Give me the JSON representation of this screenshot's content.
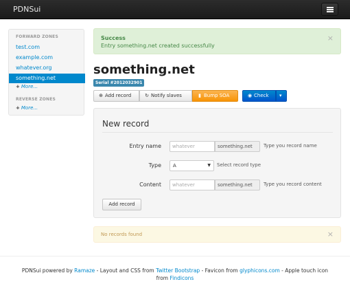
{
  "navbar": {
    "brand": "PDNSui"
  },
  "sidebar": {
    "forward_header": "FORWARD ZONES",
    "forward_items": [
      "test.com",
      "example.com",
      "whatever.org",
      "something.net"
    ],
    "forward_more": "More...",
    "reverse_header": "REVERSE ZONES",
    "reverse_more": "More..."
  },
  "alert": {
    "title": "Success",
    "message": "Entry something.net created successfully",
    "close": "×"
  },
  "zone": {
    "title": "something.net",
    "serial": "Serial #2012032901"
  },
  "toolbar": {
    "add_record": "Add record",
    "notify": "Notify slaves",
    "bump": "Bump SOA",
    "check": "Check",
    "caret": "▾"
  },
  "form": {
    "legend": "New record",
    "entry_label": "Entry name",
    "entry_placeholder": "whatever",
    "entry_addon": "something.net",
    "entry_help": "Type you record name",
    "type_label": "Type",
    "type_value": "A",
    "type_help": "Select record type",
    "content_label": "Content",
    "content_placeholder": "whatever",
    "content_addon": "something.net",
    "content_help": "Type you record content",
    "submit": "Add record"
  },
  "records": {
    "empty": "No records found",
    "close": "×"
  },
  "footer": {
    "t1": "PDNSui powered by ",
    "ramaze": "Ramaze",
    "t2": " - Layout and CSS from ",
    "bootstrap": "Twitter Bootstrap",
    "t3": " - Favicon from ",
    "glyph": "glyphicons.com",
    "t4": " - Apple touch icon",
    "t5": "from ",
    "findicons": "Findicons"
  },
  "colors": {
    "accent": "#0088cc",
    "success": "#468847",
    "warning": "#f89406",
    "label": "#3a87ad"
  }
}
